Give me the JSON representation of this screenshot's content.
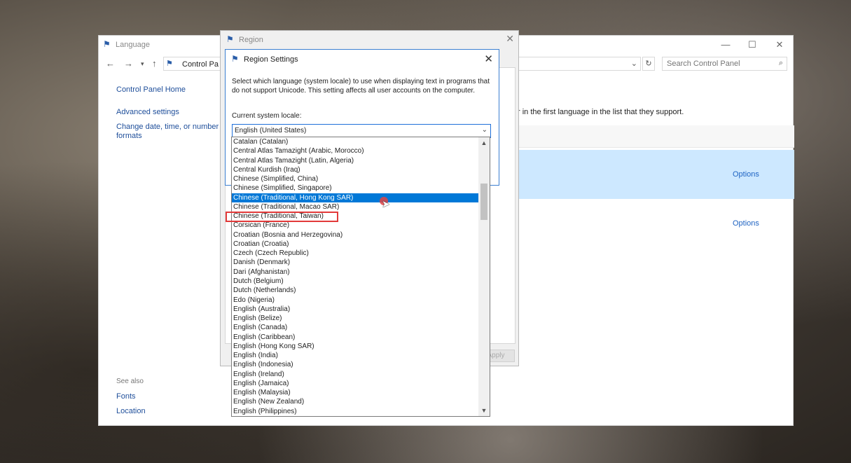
{
  "language_window": {
    "title": "Language",
    "breadcrumb": "Control Pa",
    "search_placeholder": "Search Control Panel",
    "sidebar": {
      "control_panel_home": "Control Panel Home",
      "advanced_settings": "Advanced settings",
      "change_date_line1": "Change date, time, or number",
      "change_date_line2": "formats"
    },
    "see_also": {
      "heading": "See also",
      "fonts": "Fonts",
      "location": "Location"
    },
    "preference_text": "r in the first language in the list that they support.",
    "options": [
      "Options",
      "Options"
    ]
  },
  "region_window": {
    "title": "Region",
    "apply_label": "Apply"
  },
  "region_settings": {
    "title": "Region Settings",
    "description": "Select which language (system locale) to use when displaying text in programs that do not support Unicode. This setting affects all user accounts on the computer.",
    "locale_label": "Current system locale:",
    "selected_locale": "English (United States)"
  },
  "locale_list": {
    "items": [
      "Catalan (Catalan)",
      "Central Atlas Tamazight (Arabic, Morocco)",
      "Central Atlas Tamazight (Latin, Algeria)",
      "Central Kurdish (Iraq)",
      "Chinese (Simplified, China)",
      "Chinese (Simplified, Singapore)",
      "Chinese (Traditional, Hong Kong SAR)",
      "Chinese (Traditional, Macao SAR)",
      "Chinese (Traditional, Taiwan)",
      "Corsican (France)",
      "Croatian (Bosnia and Herzegovina)",
      "Croatian (Croatia)",
      "Czech (Czech Republic)",
      "Danish (Denmark)",
      "Dari (Afghanistan)",
      "Dutch (Belgium)",
      "Dutch (Netherlands)",
      "Edo (Nigeria)",
      "English (Australia)",
      "English (Belize)",
      "English (Canada)",
      "English (Caribbean)",
      "English (Hong Kong SAR)",
      "English (India)",
      "English (Indonesia)",
      "English (Ireland)",
      "English (Jamaica)",
      "English (Malaysia)",
      "English (New Zealand)",
      "English (Philippines)"
    ],
    "hovered_index": 6,
    "highlighted_index": 8
  },
  "colors": {
    "selection": "#0078d7",
    "link": "#1e4e9a",
    "highlight_box": "#e23a3a"
  }
}
